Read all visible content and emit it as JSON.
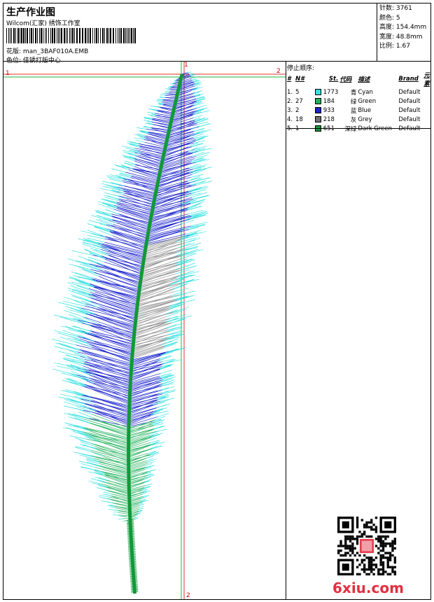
{
  "header": {
    "title": "生产作业图",
    "studio": "Wilcom(汇家) 绣饰工作室",
    "design_label": "花版:",
    "design_file": "man_3BAF010A.EMB",
    "color_label": "色位:",
    "color_value": "佳锈打版中心"
  },
  "stats": [
    {
      "label": "针数:",
      "value": "3761"
    },
    {
      "label": "颜色:",
      "value": "5"
    },
    {
      "label": "高度:",
      "value": "154.4mm"
    },
    {
      "label": "宽度:",
      "value": "48.8mm"
    },
    {
      "label": "比例:",
      "value": "1.67"
    }
  ],
  "stop_sequence": {
    "title": "停止顺序:",
    "headers": [
      "#",
      "N#",
      "St.",
      "代码",
      "描述",
      "Brand",
      "元素"
    ],
    "rows": [
      {
        "idx": "1.",
        "n": "5",
        "color": "#33e0e0",
        "stitches": "1773",
        "code": "青",
        "desc": "Cyan",
        "brand": "Default"
      },
      {
        "idx": "2.",
        "n": "27",
        "color": "#1fb05a",
        "stitches": "184",
        "code": "绿",
        "desc": "Green",
        "brand": "Default"
      },
      {
        "idx": "3.",
        "n": "2",
        "color": "#1a22cc",
        "stitches": "933",
        "code": "蓝",
        "desc": "Blue",
        "brand": "Default"
      },
      {
        "idx": "4.",
        "n": "18",
        "color": "#707070",
        "stitches": "218",
        "code": "灰",
        "desc": "Grey",
        "brand": "Default"
      },
      {
        "idx": "5.",
        "n": "1",
        "color": "#11993a",
        "stitches": "651",
        "code": "深绿",
        "desc": "Dark Green",
        "brand": "Default"
      }
    ]
  },
  "guides": {
    "h_left": "1",
    "h_right": "2",
    "v_top": "1",
    "v_bottom": "2"
  },
  "watermark": "6xiu.com",
  "stitch_colors": {
    "cyan": "#33e0e0",
    "green": "#1fb05a",
    "blue": "#1a22cc",
    "grey": "#909090",
    "dark_green": "#11993a"
  }
}
